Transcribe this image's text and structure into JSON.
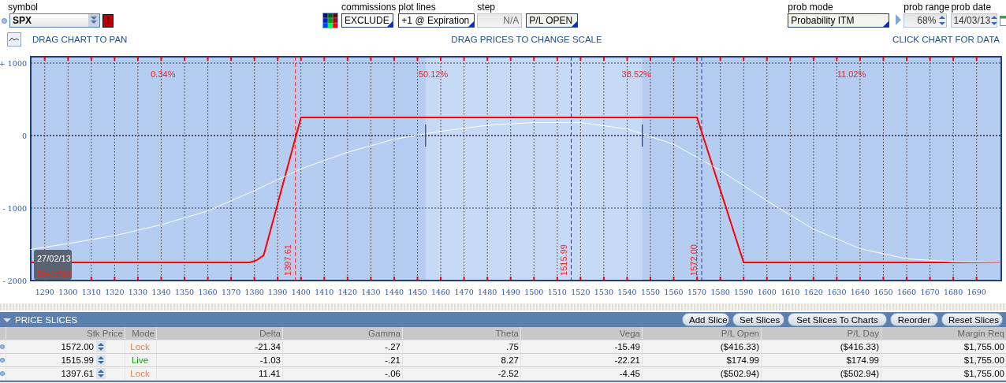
{
  "toolbar": {
    "symbol": {
      "label": "symbol",
      "value": "SPX",
      "badge": "1"
    },
    "commissions": {
      "label": "commissions",
      "value": "EXCLUDE"
    },
    "plot_lines": {
      "label": "plot lines",
      "value": "+1 @ Expiration"
    },
    "step": {
      "label": "step",
      "value": "N/A",
      "mode": "P/L OPEN"
    },
    "prob_mode": {
      "label": "prob mode",
      "value": "Probability ITM"
    },
    "prob_range": {
      "label": "prob range",
      "value": "68%"
    },
    "prob_date": {
      "label": "prob date",
      "value": "14/03/13"
    }
  },
  "hints": [
    "DRAG CHART TO PAN",
    "DRAG PRICES TO CHANGE SCALE",
    "CLICK CHART FOR DATA"
  ],
  "chart": {
    "date_box": {
      "start": "27/02/13",
      "end": "15/03/13"
    },
    "chart_data": {
      "type": "line",
      "grid": true,
      "xlim": [
        1284,
        1700.6
      ],
      "ylim": [
        -2000,
        1087
      ],
      "xticks": [
        1290,
        1300,
        1310,
        1320,
        1330,
        1340,
        1350,
        1360,
        1370,
        1380,
        1390,
        1400,
        1410,
        1420,
        1430,
        1440,
        1450,
        1460,
        1470,
        1480,
        1490,
        1500,
        1510,
        1520,
        1530,
        1540,
        1550,
        1560,
        1570,
        1580,
        1590,
        1600,
        1610,
        1620,
        1630,
        1640,
        1650,
        1660,
        1670,
        1680,
        1690
      ],
      "yticks": [
        {
          "value": 1000,
          "label": "+ 1000"
        },
        {
          "value": 0,
          "label": "0"
        },
        {
          "value": -1000,
          "label": "- 1000"
        },
        {
          "value": -2000,
          "label": "- 2000"
        }
      ],
      "series": [
        {
          "color": "#ff0000",
          "x": [
            1284,
            1378,
            1381,
            1384,
            1400,
            1570,
            1590,
            1700
          ],
          "values": [
            -1750,
            -1750,
            -1720,
            -1650,
            250,
            250,
            -1750,
            -1750
          ]
        },
        {
          "color": "#ffffff",
          "x": [
            1284,
            1300,
            1320,
            1340,
            1360,
            1380,
            1400,
            1420,
            1440,
            1460,
            1480,
            1500,
            1520,
            1540,
            1560,
            1580,
            1600,
            1620,
            1640,
            1660,
            1680,
            1700
          ],
          "values": [
            -1570,
            -1490,
            -1380,
            -1230,
            -1040,
            -760,
            -460,
            -230,
            -50,
            60,
            140,
            180,
            180,
            90,
            -120,
            -480,
            -900,
            -1290,
            -1560,
            -1700,
            -1740,
            -1750
          ]
        }
      ],
      "bands": [
        {
          "axis": "x",
          "from": 1453.5,
          "to": 1546.5
        }
      ],
      "ref_lines": [
        {
          "axis": "y",
          "value": 0
        },
        {
          "axis": "x",
          "value": 1397.61,
          "label": "1397.61",
          "color": "#ff2020"
        },
        {
          "axis": "x",
          "value": 1515.99,
          "label": "1515.99",
          "color": "#2a3a8a"
        },
        {
          "axis": "x",
          "value": 1572.0,
          "label": "1572.00",
          "color": "#2a3a8a"
        }
      ],
      "annotations": [
        "0.34%",
        "50.12%",
        "38.52%",
        "11.02%"
      ]
    }
  },
  "price_slices": {
    "title": "PRICE SLICES",
    "expanded": true,
    "buttons": [
      "Add Slice",
      "Set Slices",
      "Set Slices To Charts",
      "Reorder",
      "Reset Slices"
    ],
    "columns": [
      "Stk Price",
      "Mode",
      "Delta",
      "Gamma",
      "Theta",
      "Vega",
      "P/L Open",
      "P/L Day",
      "Margin Req"
    ],
    "rows": [
      {
        "locked": true,
        "cells": [
          "1572.00",
          "Lock",
          "-21.34",
          "-.27",
          ".75",
          "-15.49",
          "($416.33)",
          "($416.33)",
          "$1,755.00"
        ]
      },
      {
        "locked": false,
        "cells": [
          "1515.99",
          "Live",
          "-1.03",
          "-.21",
          "8.27",
          "-22.21",
          "$174.99",
          "$174.99",
          "$1,755.00"
        ]
      },
      {
        "locked": true,
        "cells": [
          "1397.61",
          "Lock",
          "11.41",
          "-.06",
          "-2.52",
          "-4.45",
          "($502.94)",
          "($502.94)",
          "$1,755.00"
        ]
      }
    ]
  }
}
